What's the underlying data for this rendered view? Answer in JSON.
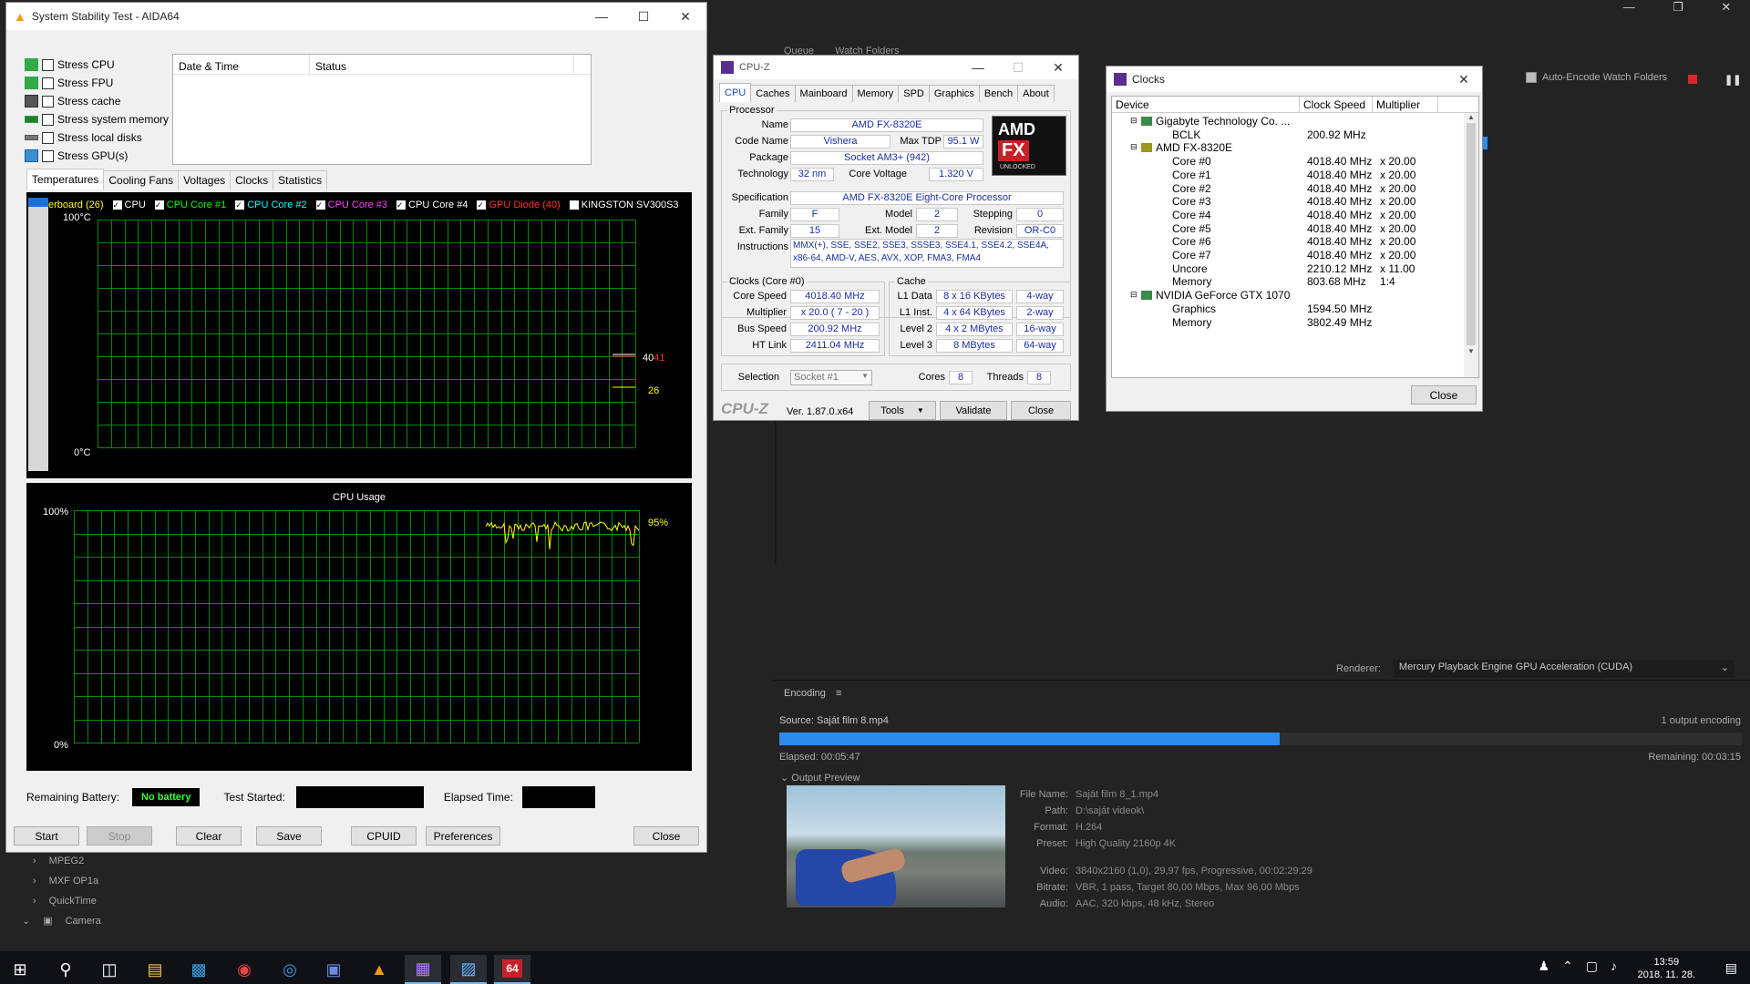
{
  "ame": {
    "tabs": [
      "Queue",
      "Watch Folders"
    ],
    "auto_encode": "Auto-Encode Watch Folders",
    "list_items": [
      "MPEG2",
      "MXF OP1a",
      "QuickTime",
      "Camera"
    ],
    "renderer_label": "Renderer:",
    "renderer_value": "Mercury Playback Engine GPU Acceleration (CUDA)",
    "encoding_title": "Encoding",
    "source": "Source: Saját film 8.mp4",
    "output_count": "1 output encoding",
    "progress": 0.52,
    "elapsed": "Elapsed: 00:05:47",
    "remaining": "Remaining: 00:03:15",
    "output_preview": "Output Preview",
    "file_name_k": "File Name:",
    "file_name": "Saját film 8_1.mp4",
    "path_k": "Path:",
    "path": "D:\\saját videok\\",
    "format_k": "Format:",
    "format": "H.264",
    "preset_k": "Preset:",
    "preset": "High Quality 2160p 4K",
    "video_k": "Video:",
    "video": "3840x2160 (1,0), 29,97 fps, Progressive, 00:02:29:29",
    "bitrate_k": "Bitrate:",
    "bitrate": "VBR, 1 pass, Target 80,00 Mbps, Max 96,00 Mbps",
    "audio_k": "Audio:",
    "audio": "AAC, 320 kbps, 48 kHz, Stereo"
  },
  "aida": {
    "title": "System Stability Test - AIDA64",
    "stress": [
      "Stress CPU",
      "Stress FPU",
      "Stress cache",
      "Stress system memory",
      "Stress local disks",
      "Stress GPU(s)"
    ],
    "col_date": "Date & Time",
    "col_status": "Status",
    "tabs": [
      "Temperatures",
      "Cooling Fans",
      "Voltages",
      "Clocks",
      "Statistics"
    ],
    "legend": [
      {
        "label": "erboard (26)",
        "color": "#ffff00"
      },
      {
        "label": "CPU",
        "color": "#ffffff"
      },
      {
        "label": "CPU Core #1",
        "color": "#00ff00"
      },
      {
        "label": "CPU Core #2",
        "color": "#00ffff"
      },
      {
        "label": "CPU Core #3",
        "color": "#ff00ff"
      },
      {
        "label": "CPU Core #4",
        "color": "#ffffff"
      },
      {
        "label": "GPU Diode (40)",
        "color": "#ff3030"
      },
      {
        "label": "KINGSTON SV300S3",
        "color": "#ffffff"
      }
    ],
    "temp_top": "100°C",
    "temp_bottom": "0°C",
    "temp_val1": "40",
    "temp_val1b": "41",
    "temp_val2": "26",
    "usage_title": "CPU Usage",
    "usage_top": "100%",
    "usage_bottom": "0%",
    "usage_val": "95%",
    "battery_label": "Remaining Battery:",
    "battery_value": "No battery",
    "started_label": "Test Started:",
    "elapsed_label": "Elapsed Time:",
    "buttons": [
      "Start",
      "Stop",
      "Clear",
      "Save",
      "CPUID",
      "Preferences",
      "Close"
    ]
  },
  "cpuz": {
    "title": "CPU-Z",
    "tabs": [
      "CPU",
      "Caches",
      "Mainboard",
      "Memory",
      "SPD",
      "Graphics",
      "Bench",
      "About"
    ],
    "processor": "Processor",
    "name_k": "Name",
    "name": "AMD FX-8320E",
    "code_k": "Code Name",
    "code": "Vishera",
    "tdp_k": "Max TDP",
    "tdp": "95.1 W",
    "package_k": "Package",
    "package": "Socket AM3+ (942)",
    "tech_k": "Technology",
    "tech": "32 nm",
    "cv_k": "Core Voltage",
    "cv": "1.320 V",
    "spec_k": "Specification",
    "spec": "AMD FX-8320E Eight-Core Processor",
    "family_k": "Family",
    "family": "F",
    "model_k": "Model",
    "model": "2",
    "stepping_k": "Stepping",
    "stepping": "0",
    "efam_k": "Ext. Family",
    "efam": "15",
    "emodel_k": "Ext. Model",
    "emodel": "2",
    "rev_k": "Revision",
    "rev": "OR-C0",
    "instr_k": "Instructions",
    "instr1": "MMX(+), SSE, SSE2, SSE3, SSSE3, SSE4.1, SSE4.2, SSE4A,",
    "instr2": "x86-64, AMD-V, AES, AVX, XOP, FMA3, FMA4",
    "clocks_title": "Clocks (Core #0)",
    "cs_k": "Core Speed",
    "cs": "4018.40 MHz",
    "mult_k": "Multiplier",
    "mult": "x 20.0 ( 7 - 20 )",
    "bus_k": "Bus Speed",
    "bus": "200.92 MHz",
    "ht_k": "HT Link",
    "ht": "2411.04 MHz",
    "cache_title": "Cache",
    "l1d_k": "L1 Data",
    "l1d": "8 x 16 KBytes",
    "l1d_w": "4-way",
    "l1i_k": "L1 Inst.",
    "l1i": "4 x 64 KBytes",
    "l1i_w": "2-way",
    "l2_k": "Level 2",
    "l2": "4 x 2 MBytes",
    "l2_w": "16-way",
    "l3_k": "Level 3",
    "l3": "8 MBytes",
    "l3_w": "64-way",
    "sel_k": "Selection",
    "sel": "Socket #1",
    "cores_k": "Cores",
    "cores": "8",
    "threads_k": "Threads",
    "threads": "8",
    "brand": "CPU-Z",
    "ver": "Ver. 1.87.0.x64",
    "tools": "Tools",
    "validate": "Validate",
    "close": "Close",
    "logo_amd": "AMD",
    "logo_fx": "FX",
    "logo_unlocked": "UNLOCKED"
  },
  "clocks": {
    "title": "Clocks",
    "cols": [
      "Device",
      "Clock Speed",
      "Multiplier"
    ],
    "rows": [
      {
        "name": "Gigabyte Technology Co. ...",
        "speed": "",
        "mult": ""
      },
      {
        "name": "BCLK",
        "speed": "200.92 MHz",
        "mult": ""
      },
      {
        "name": "AMD FX-8320E",
        "speed": "",
        "mult": ""
      },
      {
        "name": "Core #0",
        "speed": "4018.40 MHz",
        "mult": "x 20.00"
      },
      {
        "name": "Core #1",
        "speed": "4018.40 MHz",
        "mult": "x 20.00"
      },
      {
        "name": "Core #2",
        "speed": "4018.40 MHz",
        "mult": "x 20.00"
      },
      {
        "name": "Core #3",
        "speed": "4018.40 MHz",
        "mult": "x 20.00"
      },
      {
        "name": "Core #4",
        "speed": "4018.40 MHz",
        "mult": "x 20.00"
      },
      {
        "name": "Core #5",
        "speed": "4018.40 MHz",
        "mult": "x 20.00"
      },
      {
        "name": "Core #6",
        "speed": "4018.40 MHz",
        "mult": "x 20.00"
      },
      {
        "name": "Core #7",
        "speed": "4018.40 MHz",
        "mult": "x 20.00"
      },
      {
        "name": "Uncore",
        "speed": "2210.12 MHz",
        "mult": "x 11.00"
      },
      {
        "name": "Memory",
        "speed": "803.68 MHz",
        "mult": "1:4"
      },
      {
        "name": "NVIDIA GeForce GTX 1070",
        "speed": "",
        "mult": ""
      },
      {
        "name": "Graphics",
        "speed": "1594.50 MHz",
        "mult": ""
      },
      {
        "name": "Memory",
        "speed": "3802.49 MHz",
        "mult": ""
      }
    ],
    "close": "Close"
  },
  "taskbar": {
    "time": "13:59",
    "date": "2018. 11. 28.",
    "aida_label": "64"
  }
}
